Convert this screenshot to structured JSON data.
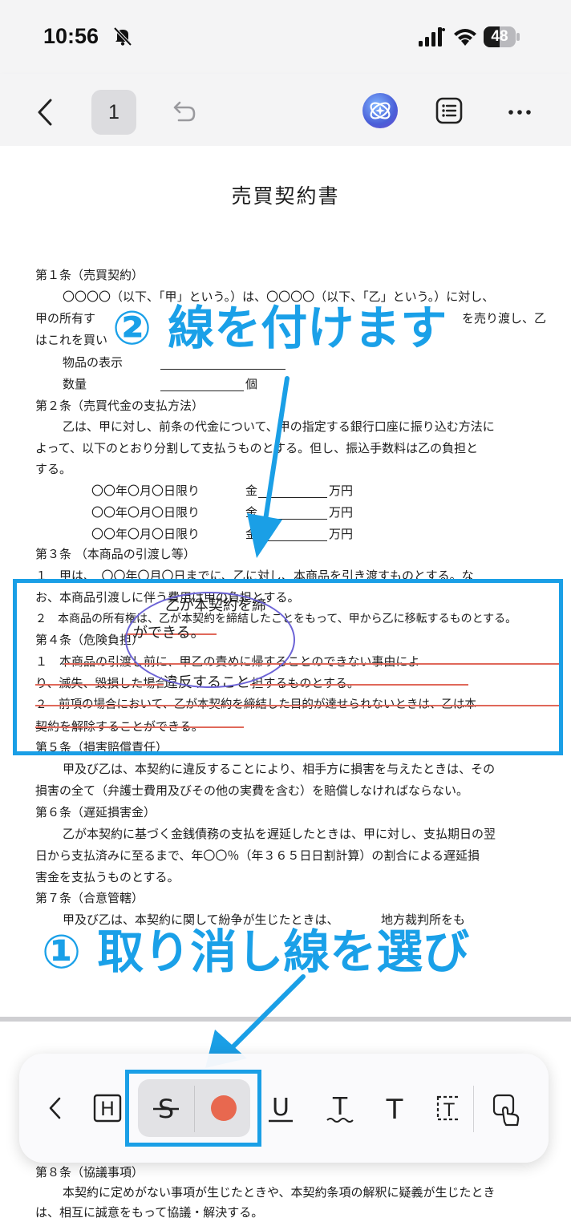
{
  "status": {
    "time": "10:56",
    "battery": "48"
  },
  "nav": {
    "page_number": "1"
  },
  "document": {
    "title": "売買契約書",
    "lines": [
      "第１条（売買契約）",
      "〇〇〇〇（以下、「甲」という。）は、〇〇〇〇（以下、「乙」という。）に対し、",
      "甲の所有す",
      "を売り渡し、乙",
      "はこれを買い",
      "物品の表示",
      "数量",
      "個",
      "第２条（売買代金の支払方法）",
      "乙は、甲に対し、前条の代金について、甲の指定する銀行口座に振り込む方法に",
      "よって、以下のとおり分割して支払うものとする。但し、振込手数料は乙の負担と",
      "する。",
      "〇〇年〇月〇日限り",
      "金",
      "万円",
      "第３条 （本商品の引渡し等）",
      "１　甲は、　〇〇年〇月〇日までに、乙に対し、本商品を引き渡すものとする。な",
      "お、本商品引渡しに伴う費用は甲の負担とする。",
      "２　本商品の所有権は、乙が本契約を締結したことをもって、甲から乙に移転するものとする。",
      "第４条（危険負担）",
      "１　本商品の引渡し前に、甲乙の責めに帰することのできない事由によ",
      "り、滅失、毀損した場合の損害を甲が負担するものとする。",
      "２　前項の場合において、乙が本契約を締結した目的が達せられないときは、乙は本",
      "契約を解除することができる。",
      "第５条（損害賠償責任）",
      "甲及び乙は、本契約に違反することにより、相手方に損害を与えたときは、その",
      "損害の全て（弁護士費用及びその他の実費を含む）を賠償しなければならない。",
      "第６条（遅延損害金）",
      "乙が本契約に基づく金銭債務の支払を遅延したときは、甲に対し、支払期日の翌",
      "日から支払済みに至るまで、年〇〇％（年３６５日日割計算）の割合による遅延損",
      "害金を支払うものとする。",
      "第７条（合意管轄）",
      "甲及び乙は、本契約に関して紛争が生じたときは、　　　　地方裁判所をも",
      "第８条（協議事項）",
      "本契約に定めがない事項が生じたときや、本契約条項の解釈に疑義が生じたとき",
      "は、相互に誠意をもって協議・解決する。"
    ],
    "handwritten": [
      "乙が本契約を締",
      "ができる。",
      "違反すること"
    ]
  },
  "callouts": {
    "step2": "② 線を付けます",
    "step1": "① 取り消し線を選び"
  },
  "toolbar": {
    "highlight_glyph": "H",
    "strike_glyph": "S",
    "underline_glyph": "U",
    "squiggle_glyph": "T",
    "text_glyph": "T",
    "textbox_glyph": "T",
    "selected_color": "#e8684f"
  }
}
